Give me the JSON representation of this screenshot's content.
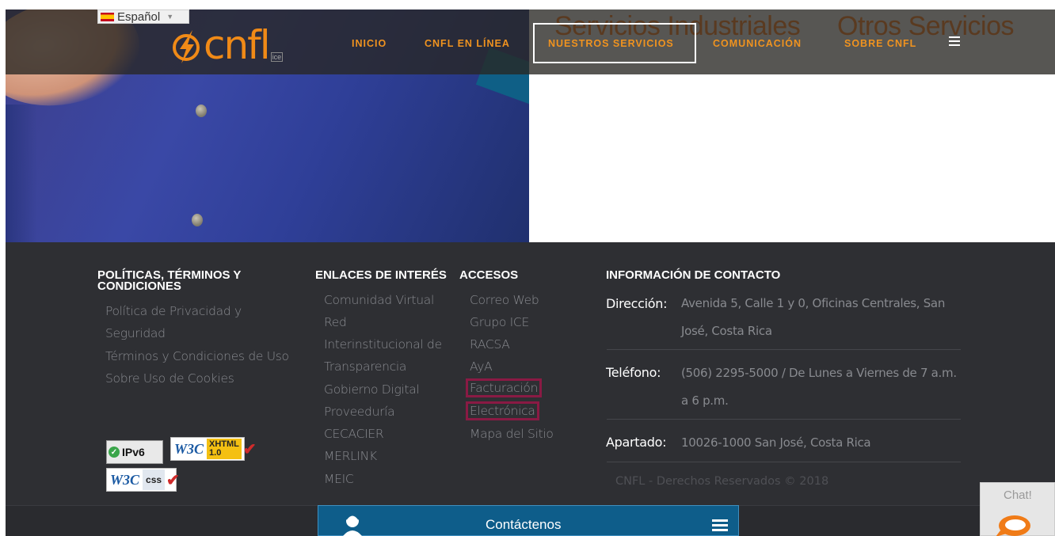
{
  "language": {
    "selected": "Español"
  },
  "brand": {
    "logo_text": "cnfl",
    "logo_sub": "ice"
  },
  "nav": {
    "ghost_left": "Servicios Industriales",
    "ghost_right": "Otros Servicios",
    "items": [
      {
        "label": "INICIO"
      },
      {
        "label": "CNFL EN LÍNEA"
      },
      {
        "label": "NUESTROS SERVICIOS"
      },
      {
        "label": "COMUNICACIÓN"
      },
      {
        "label": "SOBRE CNFL"
      }
    ]
  },
  "footer": {
    "policies": {
      "title": "POLÍTICAS, TÉRMINOS Y CONDICIONES",
      "links": [
        "Política de Privacidad y",
        "Seguridad",
        "Términos y Condiciones de Uso",
        "Sobre Uso de Cookies"
      ]
    },
    "links_of_interest": {
      "title": "ENLACES DE INTERÉS",
      "links": [
        "Comunidad Virtual",
        "Red",
        "Interinstitucional de",
        "Transparencia",
        "Gobierno Digital",
        "Proveeduría",
        "CECACIER",
        "MERLINK",
        "MEIC"
      ]
    },
    "access": {
      "title": "ACCESOS",
      "links": [
        "Correo Web",
        "Grupo ICE",
        "RACSA",
        "AyA",
        "Facturación",
        "Electrónica",
        "Mapa del Sitio"
      ]
    },
    "contact": {
      "title": "INFORMACIÓN DE CONTACTO",
      "address_label": "Dirección:",
      "address_line1": "Avenida 5, Calle 1 y 0, Oficinas Centrales, San",
      "address_line2": "José, Costa Rica",
      "phone_label": "Teléfono:",
      "phone_line1": "(506) 2295-5000 / De Lunes a Viernes de 7 a.m.",
      "phone_line2": "a 6 p.m.",
      "pobox_label": "Apartado:",
      "pobox_value": "10026-1000 San José, Costa Rica"
    },
    "copyright": "CNFL - Derechos Reservados © 2018",
    "badges": {
      "ipv6": "IPv6",
      "w3c": "W3C",
      "xhtml_top": "XHTML",
      "xhtml_ver": "1.0",
      "css": "css"
    }
  },
  "contact_bar": {
    "label": "Contáctenos"
  },
  "chat": {
    "label": "Chat!"
  }
}
